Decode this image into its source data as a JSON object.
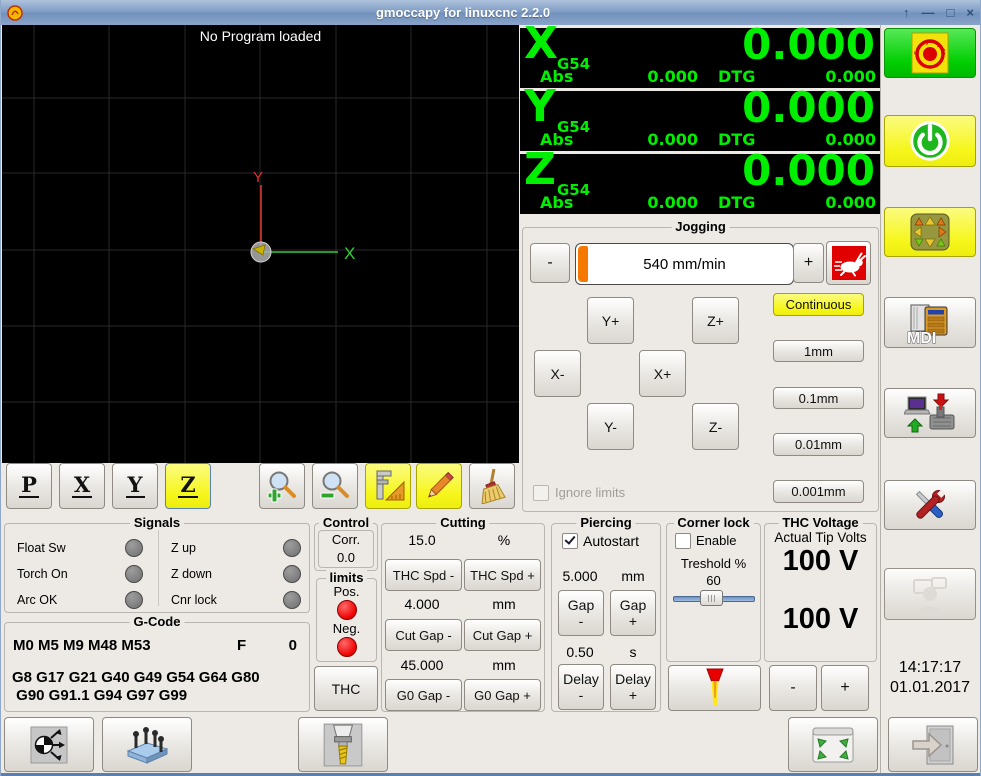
{
  "window": {
    "title": "gmoccapy for linuxcnc  2.2.0",
    "controls": {
      "shade": "↑",
      "minimize": "—",
      "maximize": "□",
      "close": "×"
    }
  },
  "preview": {
    "message": "No Program loaded",
    "x_axis": "X",
    "y_axis": "Y",
    "views": {
      "p": "P",
      "x": "X",
      "y": "Y",
      "z": "Z"
    }
  },
  "dro": {
    "system": "G54",
    "abs_label": "Abs",
    "dtg_label": "DTG",
    "axes": [
      {
        "letter": "X",
        "value": "0.000",
        "abs": "0.000",
        "dtg": "0.000"
      },
      {
        "letter": "Y",
        "value": "0.000",
        "abs": "0.000",
        "dtg": "0.000"
      },
      {
        "letter": "Z",
        "value": "0.000",
        "abs": "0.000",
        "dtg": "0.000"
      }
    ]
  },
  "jogging": {
    "title": "Jogging",
    "minus": "-",
    "plus": "+",
    "speed": "540 mm/min",
    "buttons": {
      "y_plus": "Y+",
      "z_plus": "Z+",
      "x_minus": "X-",
      "x_plus": "X+",
      "y_minus": "Y-",
      "z_minus": "Z-"
    },
    "increments": [
      "Continuous",
      "1mm",
      "0.1mm",
      "0.01mm",
      "0.001mm"
    ],
    "ignore_limits": "Ignore limits"
  },
  "signals": {
    "title": "Signals",
    "left": [
      {
        "label": "Float Sw",
        "state": "off"
      },
      {
        "label": "Torch On",
        "state": "off"
      },
      {
        "label": "Arc OK",
        "state": "off"
      }
    ],
    "right": [
      {
        "label": "Z up",
        "state": "off"
      },
      {
        "label": "Z down",
        "state": "off"
      },
      {
        "label": "Cnr lock",
        "state": "off"
      }
    ]
  },
  "gcode": {
    "title": "G-Code",
    "mcodes": "M0 M5 M9 M48 M53",
    "f_label": "F",
    "f_value": "0",
    "gcodes_line1": "G8 G17 G21 G40 G49 G54 G64 G80",
    "gcodes_line2": " G90 G91.1 G94 G97 G99"
  },
  "control": {
    "title": "Control",
    "corr_label": "Corr.",
    "corr_value": "0.0",
    "limits_title": "limits",
    "pos_label": "Pos.",
    "neg_label": "Neg.",
    "pos_state": "on",
    "neg_state": "on",
    "thc_button": "THC"
  },
  "cutting": {
    "title": "Cutting",
    "rows": [
      {
        "value": "15.0",
        "unit": "%",
        "minus": "THC Spd -",
        "plus": "THC Spd +"
      },
      {
        "value": "4.000",
        "unit": "mm",
        "minus": "Cut Gap -",
        "plus": "Cut Gap +"
      },
      {
        "value": "45.000",
        "unit": "mm",
        "minus": "G0 Gap -",
        "plus": "G0 Gap +"
      }
    ]
  },
  "piercing": {
    "title": "Piercing",
    "autostart": "Autostart",
    "autostart_checked": true,
    "rows": [
      {
        "value": "5.000",
        "unit": "mm",
        "minus_l1": "Gap",
        "minus_l2": "-",
        "plus_l1": "Gap",
        "plus_l2": "+"
      },
      {
        "value": "0.50",
        "unit": "s",
        "minus_l1": "Delay",
        "minus_l2": "-",
        "plus_l1": "Delay",
        "plus_l2": "+"
      }
    ]
  },
  "corner_lock": {
    "title": "Corner lock",
    "enable": "Enable",
    "enable_checked": false,
    "threshold_label": "Treshold %",
    "threshold_value": "60"
  },
  "thc_voltage": {
    "title": "THC Voltage",
    "actual_label": "Actual Tip Volts",
    "target": "100 V",
    "actual": "100 V",
    "minus": "-",
    "plus": "+"
  },
  "clock": {
    "time": "14:17:17",
    "date": "01.01.2017"
  },
  "sidebar": {
    "mdi_label": "MDI"
  },
  "colors": {
    "dro_green": "#00EE00",
    "estop_green": "#00CE00",
    "active_yellow": "#F6F61A",
    "slider_orange": "#F57900",
    "led_red": "#EE0000",
    "titlebar_blue": "#7F9CC4"
  }
}
